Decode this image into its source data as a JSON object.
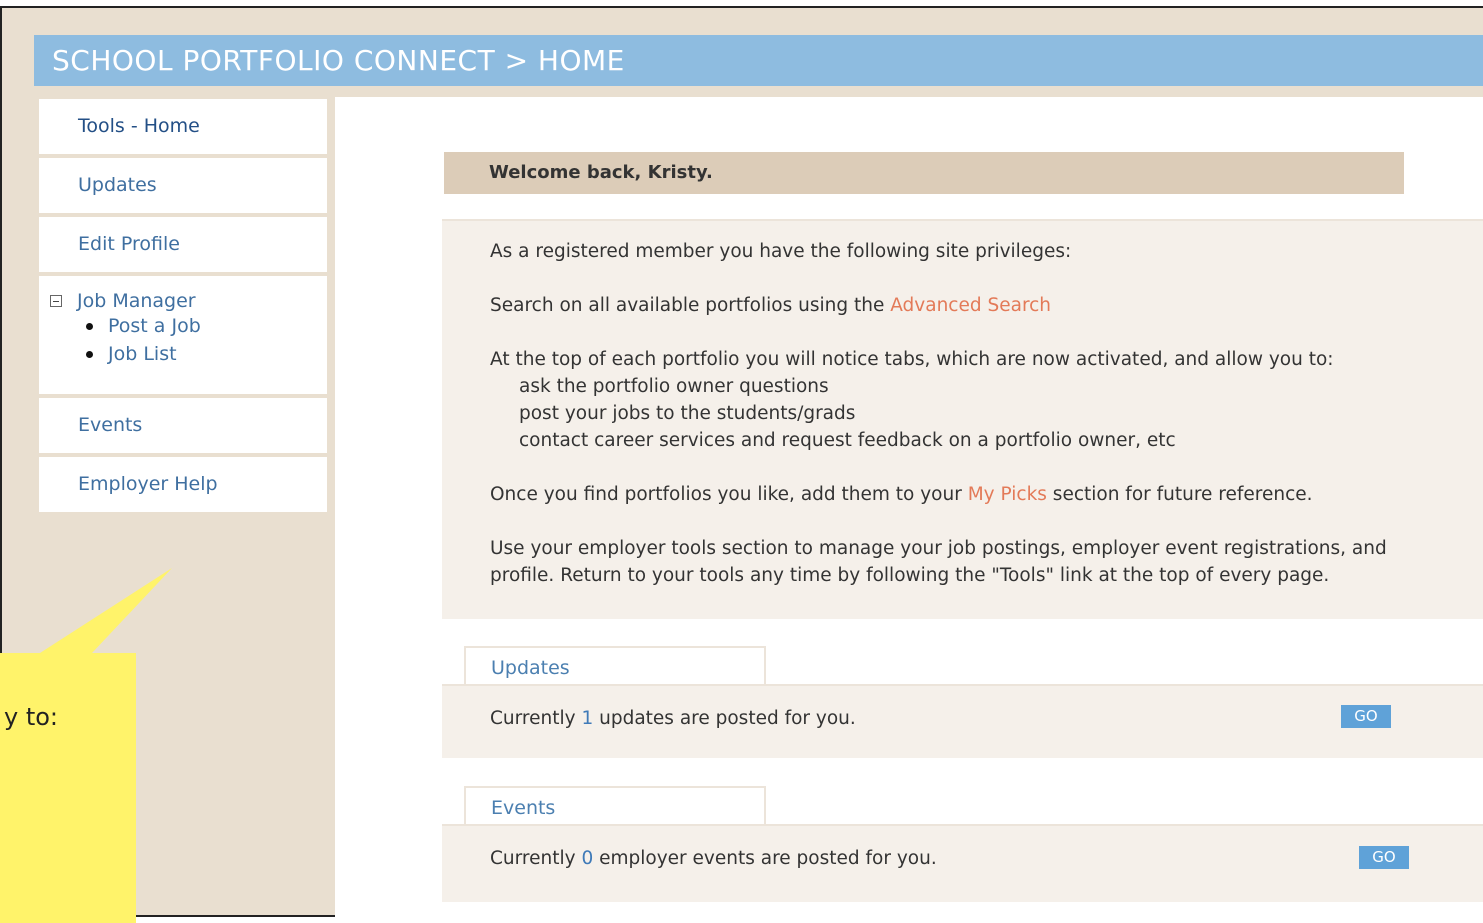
{
  "header": {
    "title": "SCHOOL PORTFOLIO CONNECT > HOME"
  },
  "sidebar": {
    "items": [
      {
        "label": "Tools - Home"
      },
      {
        "label": "Updates"
      },
      {
        "label": "Edit Profile"
      }
    ],
    "job_manager": {
      "label": "Job Manager",
      "sub_items": [
        {
          "label": "Post a Job"
        },
        {
          "label": "Job List"
        }
      ]
    },
    "bottom_items": [
      {
        "label": "Events"
      },
      {
        "label": "Employer Help"
      }
    ]
  },
  "welcome": {
    "text": "Welcome back, Kristy."
  },
  "privileges": {
    "intro": "As a registered member you have the following site privileges:",
    "search_prefix": "Search on all available portfolios using the ",
    "search_link": "Advanced Search",
    "tabs_intro": "At the top of each portfolio you will notice tabs, which are now activated, and allow you to:",
    "tab_items": [
      "ask the portfolio owner questions",
      "post your jobs to the students/grads",
      "contact career services and request feedback on a portfolio owner, etc"
    ],
    "picks_prefix": "Once you find portfolios you like, add them to your ",
    "picks_link": "My Picks",
    "picks_suffix": " section for future reference.",
    "tools_line1": "Use your employer tools section to manage your job postings, employer event registrations, and",
    "tools_line2": "profile. Return to your tools any time by following the \"Tools\" link at the top of every page."
  },
  "updates": {
    "tab": "Updates",
    "prefix": "Currently ",
    "count": "1",
    "suffix": " updates are posted for you.",
    "go": "GO"
  },
  "events": {
    "tab": "Events",
    "prefix": "Currently ",
    "count": "0",
    "suffix": " employer events are posted for you.",
    "go": "GO"
  },
  "callout": {
    "text": "y to:"
  }
}
